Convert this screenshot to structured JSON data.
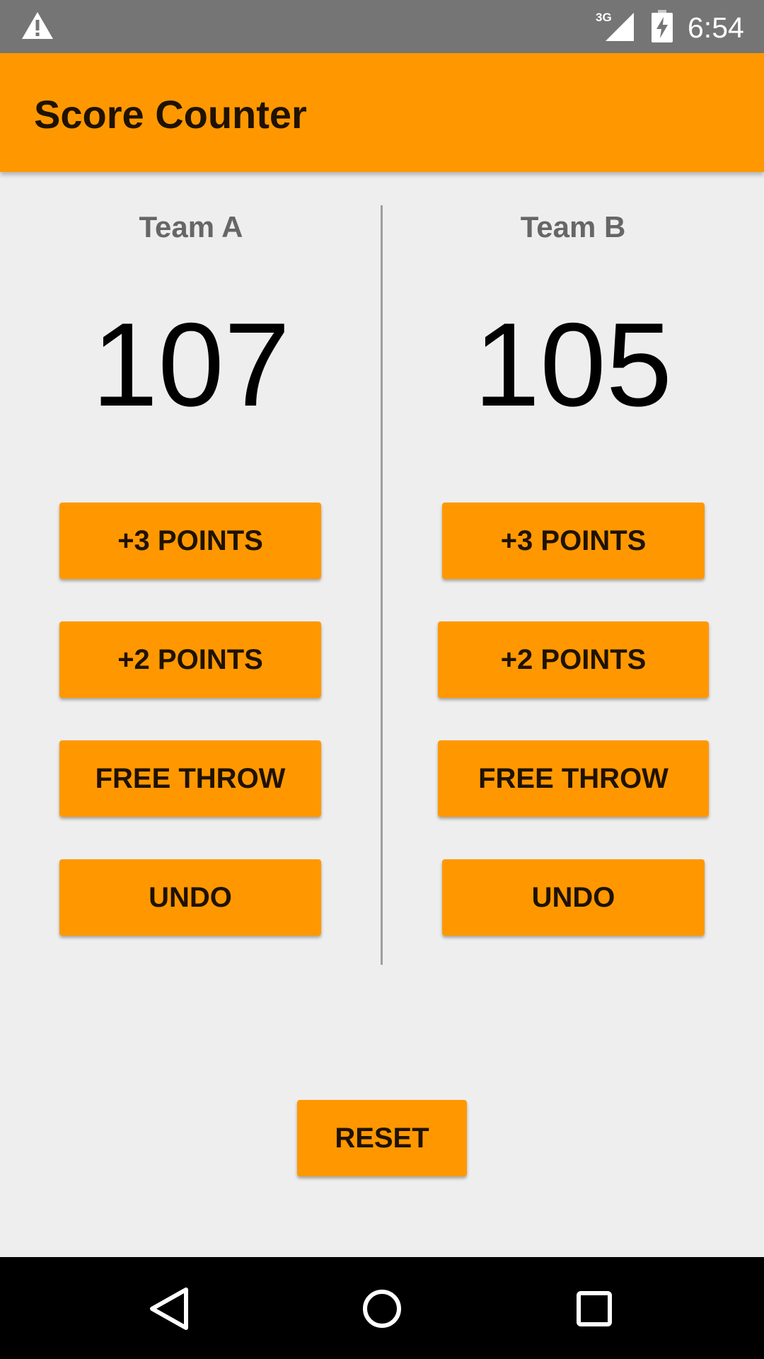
{
  "status_bar": {
    "time": "6:54",
    "network": "3G",
    "icons": [
      "warning-icon",
      "signal-icon",
      "battery-charging-icon"
    ]
  },
  "app_bar": {
    "title": "Score Counter"
  },
  "teams": [
    {
      "name": "Team A",
      "score": "107",
      "buttons": [
        "+3 POINTS",
        "+2 POINTS",
        "FREE THROW",
        "UNDO"
      ]
    },
    {
      "name": "Team B",
      "score": "105",
      "buttons": [
        "+3 POINTS",
        "+2 POINTS",
        "FREE THROW",
        "UNDO"
      ]
    }
  ],
  "reset_label": "RESET",
  "nav_bar": {
    "icons": [
      "back-icon",
      "home-icon",
      "recents-icon"
    ]
  },
  "colors": {
    "accent": "#ff9800",
    "status_bar": "#757575",
    "background": "#eeeeee"
  }
}
